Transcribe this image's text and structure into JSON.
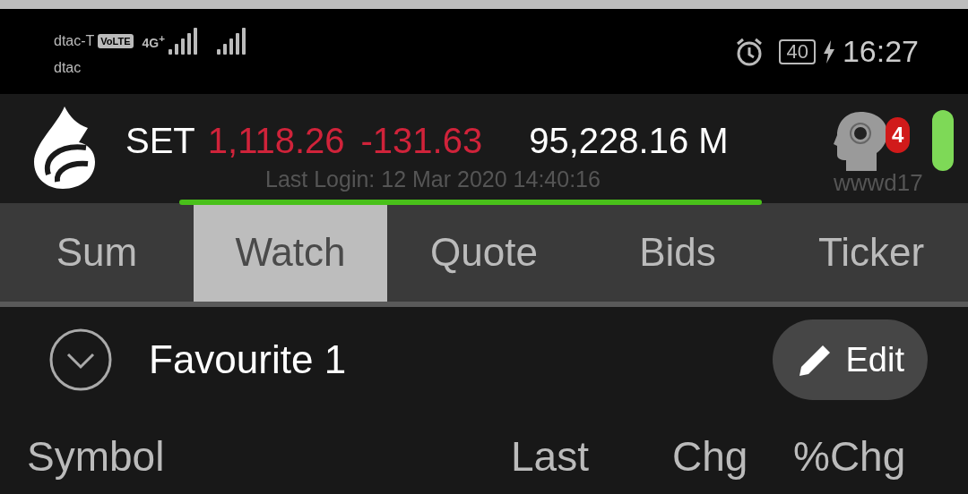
{
  "status_bar": {
    "carrier_primary": "dtac-T",
    "network_badge": "VoLTE",
    "network_type": "4G$^{+}$",
    "carrier_secondary": "dtac",
    "battery": "40",
    "time": "16:27"
  },
  "header": {
    "index_name": "SET",
    "index_value": "1,118.26",
    "index_change": "-131.63",
    "volume": "95,228.16 M",
    "last_login": "Last Login: 12 Mar 2020 14:40:16",
    "notification_count": "4",
    "username": "wwwd17"
  },
  "tabs": [
    {
      "label": "Sum",
      "selected": false
    },
    {
      "label": "Watch",
      "selected": true
    },
    {
      "label": "Quote",
      "selected": false
    },
    {
      "label": "Bids",
      "selected": false
    },
    {
      "label": "Ticker",
      "selected": false
    }
  ],
  "favourites": {
    "title": "Favourite 1",
    "edit_button": "Edit"
  },
  "columns": [
    {
      "label": "Symbol"
    },
    {
      "label": "Last"
    },
    {
      "label": "Chg"
    },
    {
      "label": "%Chg"
    }
  ]
}
